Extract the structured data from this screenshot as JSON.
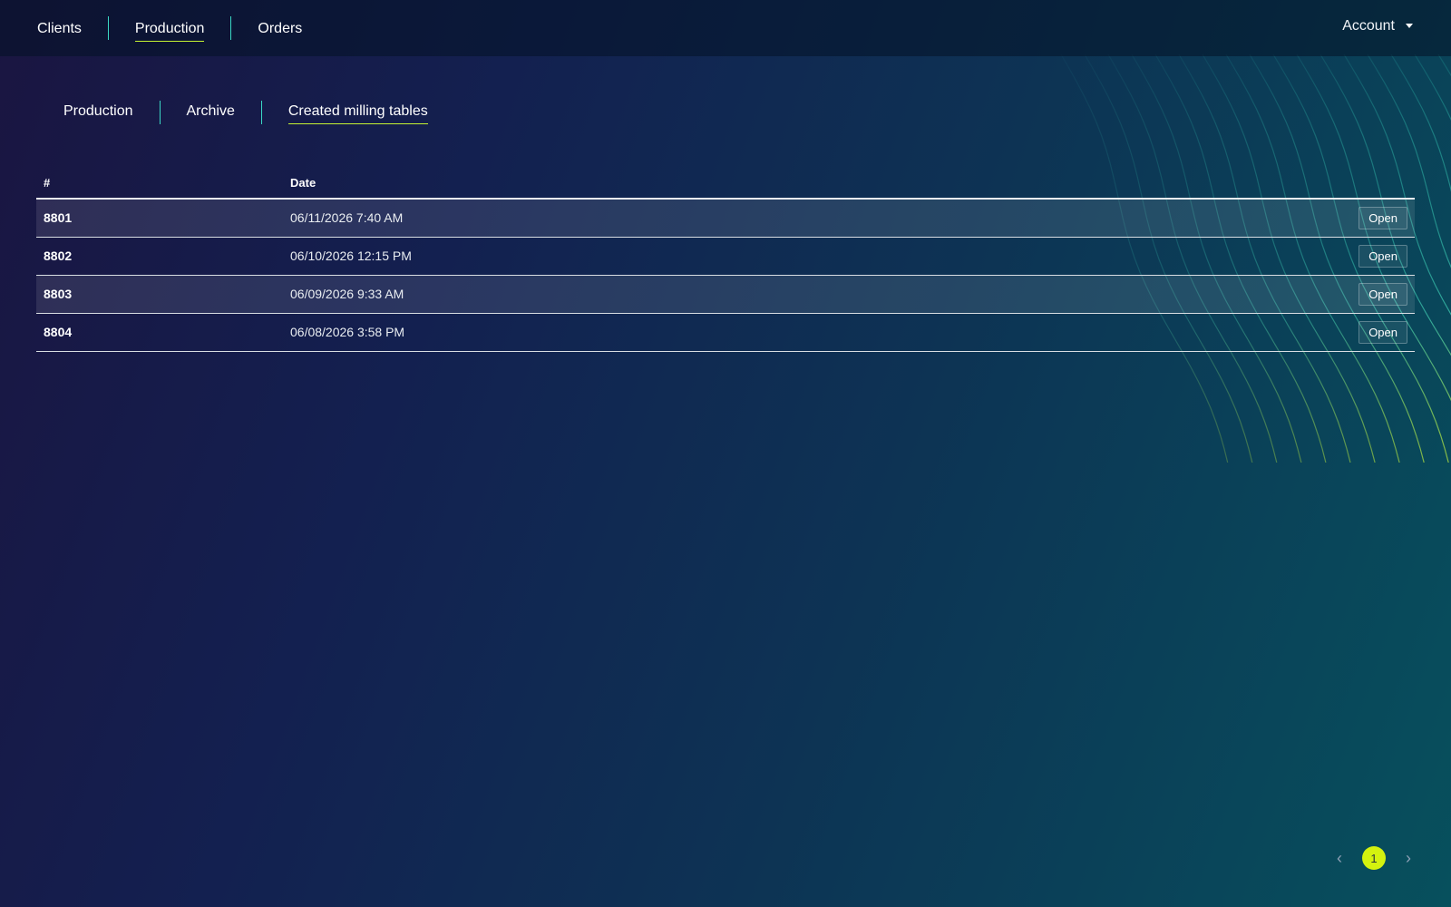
{
  "topnav": {
    "items": [
      {
        "label": "Clients",
        "active": false
      },
      {
        "label": "Production",
        "active": true
      },
      {
        "label": "Orders",
        "active": false
      }
    ],
    "account_label": "Account"
  },
  "subnav": {
    "items": [
      {
        "label": "Production",
        "active": false
      },
      {
        "label": "Archive",
        "active": false
      },
      {
        "label": "Created milling tables",
        "active": true
      }
    ]
  },
  "table": {
    "columns": [
      "#",
      "Date"
    ],
    "rows": [
      {
        "id": "8801",
        "date": "06/11/2026 7:40 AM",
        "action": "Open"
      },
      {
        "id": "8802",
        "date": "06/10/2026 12:15 PM",
        "action": "Open"
      },
      {
        "id": "8803",
        "date": "06/09/2026 9:33 AM",
        "action": "Open"
      },
      {
        "id": "8804",
        "date": "06/08/2026 3:58 PM",
        "action": "Open"
      }
    ]
  },
  "pagination": {
    "prev_icon": "chevron-left-icon",
    "next_icon": "chevron-right-icon",
    "current_page": "1"
  },
  "colors": {
    "accent": "#d4f20f",
    "separator": "#3ad8c5",
    "underline": "#c6f432"
  }
}
